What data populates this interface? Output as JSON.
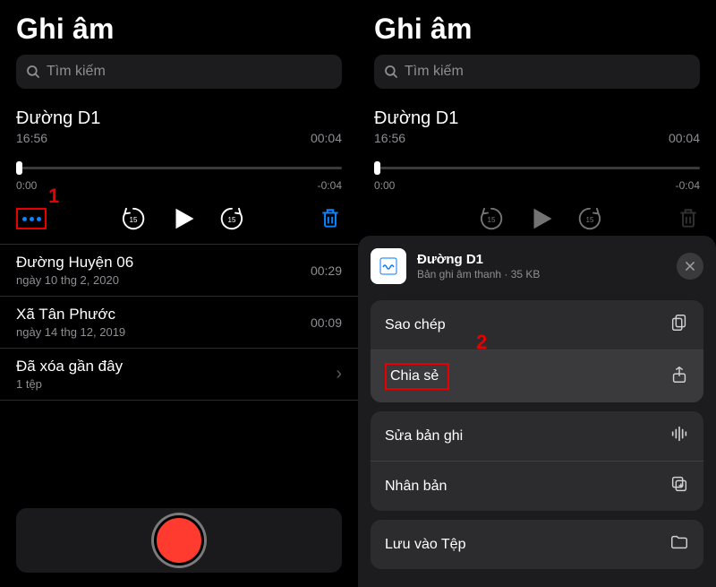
{
  "left": {
    "title": "Ghi âm",
    "search_placeholder": "Tìm kiếm",
    "selected": {
      "name": "Đường D1",
      "time": "16:56",
      "duration": "00:04",
      "elapsed": "0:00",
      "remaining": "-0:04"
    },
    "skip_label": "15",
    "annot1": "1",
    "list": [
      {
        "title": "Đường Huyện 06",
        "sub": "ngày 10 thg 2, 2020",
        "dur": "00:29"
      },
      {
        "title": "Xã Tân Phước",
        "sub": "ngày 14 thg 12, 2019",
        "dur": "00:09"
      }
    ],
    "deleted": {
      "title": "Đã xóa gần đây",
      "sub": "1 tệp"
    }
  },
  "right": {
    "title": "Ghi âm",
    "search_placeholder": "Tìm kiếm",
    "selected": {
      "name": "Đường D1",
      "time": "16:56",
      "duration": "00:04",
      "elapsed": "0:00",
      "remaining": "-0:04"
    },
    "skip_label": "15",
    "sheet": {
      "file_title": "Đường D1",
      "file_sub": "Bản ghi âm thanh · 35 KB",
      "items": {
        "copy": "Sao chép",
        "share": "Chia sẻ",
        "edit": "Sửa bản ghi",
        "duplicate": "Nhân bản",
        "save": "Lưu vào Tệp"
      }
    },
    "annot2": "2"
  }
}
